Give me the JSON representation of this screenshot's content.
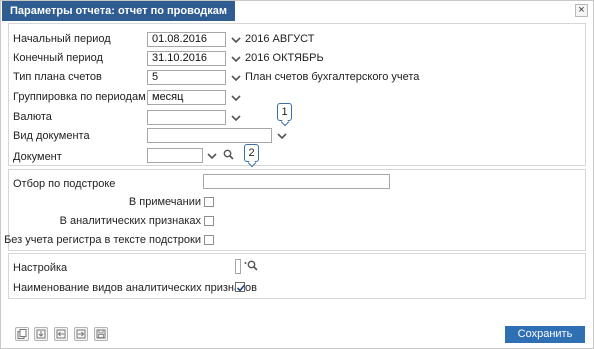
{
  "dialog": {
    "title": "Параметры отчета: отчет по проводкам",
    "close_label": "×"
  },
  "period": {
    "start_label": "Начальный период",
    "start_value": "01.08.2016",
    "start_note": "2016 АВГУСТ",
    "end_label": "Конечный период",
    "end_value": "31.10.2016",
    "end_note": "2016 ОКТЯБРЬ"
  },
  "plan": {
    "label": "Тип плана счетов",
    "value": "5",
    "note": "План счетов бухгалтерского учета"
  },
  "grouping": {
    "label": "Группировка по периодам",
    "value": "месяц"
  },
  "currency": {
    "label": "Валюта",
    "value": ""
  },
  "doc_type": {
    "label": "Вид документа",
    "value": ""
  },
  "document": {
    "label": "Документ",
    "value": ""
  },
  "callouts": [
    "1",
    "2"
  ],
  "filter": {
    "substring_label": "Отбор по подстроке",
    "substring_value": "",
    "in_notes_label": "В примечании",
    "in_notes_checked": false,
    "in_analytics_label": "В аналитических признаках",
    "in_analytics_checked": false,
    "ignore_case_label": "Без учета регистра в тексте подстроки",
    "ignore_case_checked": false
  },
  "settings": {
    "setting_label": "Настройка",
    "setting_value": "",
    "analytic_names_label": "Наименование видов аналитических признаков",
    "analytic_names_checked": true
  },
  "footer": {
    "save_label": "Сохранить"
  },
  "colors": {
    "title_bg": "#2f5d92",
    "button_bg": "#2f6fb3",
    "callout_border": "#3d6ea6"
  }
}
